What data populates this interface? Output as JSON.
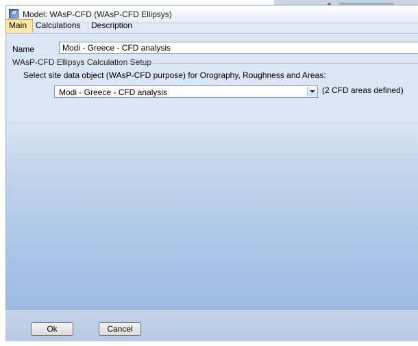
{
  "window": {
    "title": "Model: WAsP-CFD (WAsP-CFD Ellipsys)"
  },
  "tabs": [
    {
      "label": "Main",
      "active": true
    },
    {
      "label": "Calculations",
      "active": false
    },
    {
      "label": "Description",
      "active": false
    }
  ],
  "main": {
    "name_label": "Name",
    "name_value": "Modi - Greece - CFD analysis",
    "group_title": "WAsP-CFD Ellipsys Calculation Setup",
    "group_description": "Select site data object (WAsP-CFD purpose) for Orography, Roughness and Areas:",
    "site_select_value": "Modi - Greece - CFD analysis",
    "cfd_areas_note": "(2 CFD areas defined)"
  },
  "footer": {
    "ok_label": "Ok",
    "cancel_label": "Cancel"
  },
  "colors": {
    "active_tab": "#ffe7a5",
    "panel_gradient_bottom": "#9dbbe4"
  },
  "icons": {
    "app": "wasp-app-icon",
    "dropdown": "chevron-down-icon"
  }
}
